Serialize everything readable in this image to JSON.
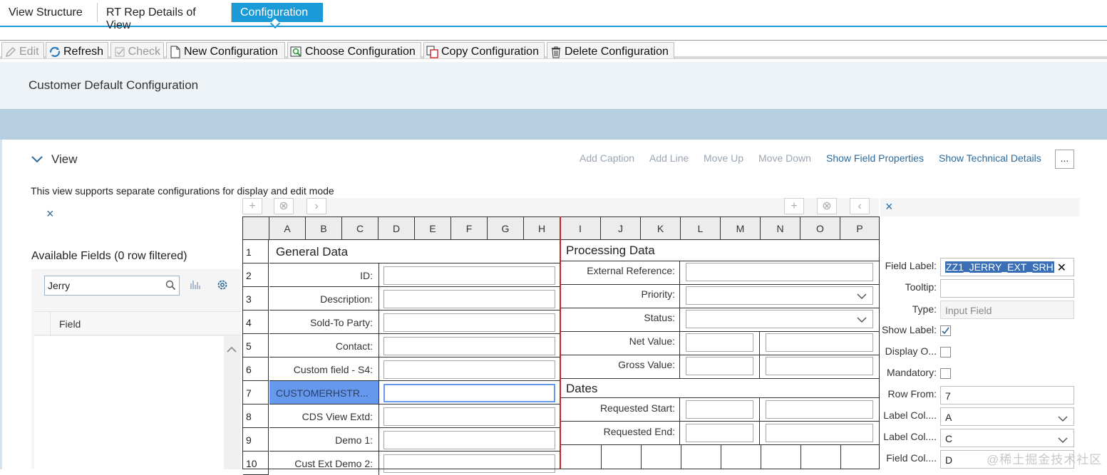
{
  "tabs": [
    {
      "label": "View Structure"
    },
    {
      "label": "RT Rep Details of View"
    },
    {
      "label": "Configuration"
    }
  ],
  "toolbar": {
    "edit": "Edit",
    "refresh": "Refresh",
    "check": "Check",
    "new_configuration": "New Configuration",
    "choose_configuration": "Choose Configuration",
    "copy_configuration": "Copy Configuration",
    "delete_configuration": "Delete Configuration"
  },
  "header": {
    "title": "Customer Default Configuration"
  },
  "view": {
    "label": "View",
    "actions": {
      "add_caption": "Add Caption",
      "add_line": "Add Line",
      "move_up": "Move Up",
      "move_down": "Move Down",
      "show_field_properties": "Show Field Properties",
      "show_technical_details": "Show Technical Details"
    },
    "more": "...",
    "info": "This view supports separate configurations for display and edit mode"
  },
  "left_panel": {
    "close": "×",
    "title": "Available Fields (0 row filtered)",
    "search_value": "Jerry",
    "column_header": "Field"
  },
  "grid_controls": {
    "add": "+",
    "remove": "⊗",
    "next": "›",
    "prev": "‹"
  },
  "grid": {
    "columns": [
      "A",
      "B",
      "C",
      "D",
      "E",
      "F",
      "G",
      "H",
      "I",
      "J",
      "K",
      "L",
      "M",
      "N",
      "O",
      "P"
    ],
    "rows": [
      "1",
      "2",
      "3",
      "4",
      "5",
      "6",
      "7",
      "8",
      "9",
      "10"
    ],
    "left": {
      "section_title": "General Data",
      "fields": [
        "ID:",
        "Description:",
        "Sold-To Party:",
        "Contact:",
        "Custom field - S4:",
        "CUSTOMERHSTR...",
        "CDS View Extd:",
        "Demo 1:",
        "Cust Ext Demo 2:"
      ]
    },
    "right": {
      "processing_title": "Processing Data",
      "processing_fields": [
        "External Reference:",
        "Priority:",
        "Status:",
        "Net Value:",
        "Gross Value:"
      ],
      "dates_title": "Dates",
      "dates_fields": [
        "Requested Start:",
        "Requested End:"
      ]
    },
    "selected_color": "#6699ee",
    "divider_color": "#cc2222"
  },
  "properties": {
    "close": "×",
    "field_label": {
      "label": "Field Label:",
      "value": "ZZ1_JERRY_EXT_SRH",
      "clear": "✕"
    },
    "tooltip": {
      "label": "Tooltip:",
      "value": ""
    },
    "type": {
      "label": "Type:",
      "value": "Input Field"
    },
    "show_label": {
      "label": "Show Label:",
      "checked": true
    },
    "display_only": {
      "label": "Display O...",
      "checked": false
    },
    "mandatory": {
      "label": "Mandatory:",
      "checked": false
    },
    "row_from": {
      "label": "Row From:",
      "value": "7"
    },
    "label_col_from": {
      "label": "Label Col....",
      "value": "A"
    },
    "label_col_to": {
      "label": "Label Col....",
      "value": "C"
    },
    "field_col_from": {
      "label": "Field Col....",
      "value": "D"
    }
  },
  "watermark": "@稀土掘金技术社区"
}
